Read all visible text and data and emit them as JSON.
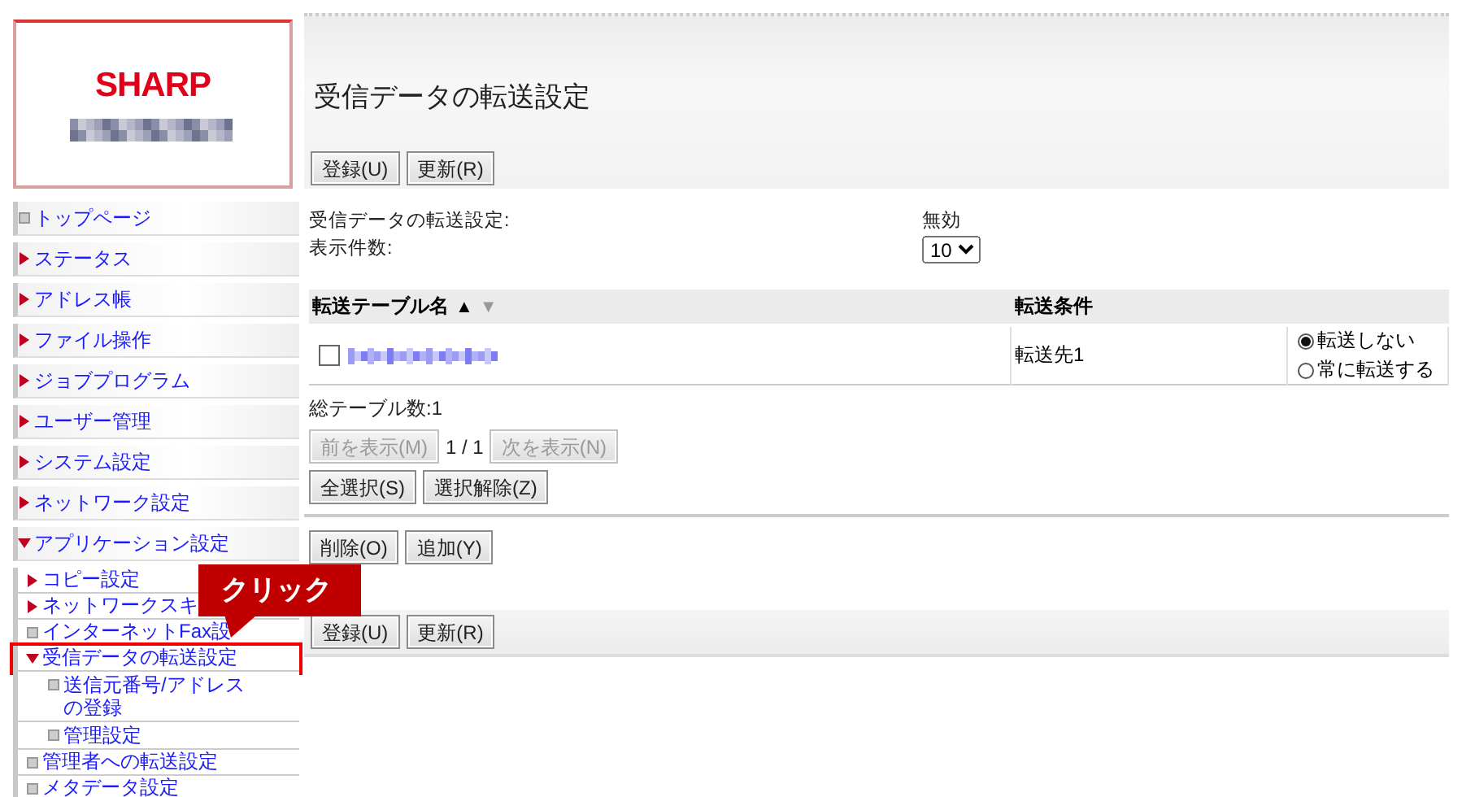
{
  "logo": {
    "brand": "SHARP"
  },
  "sidebar": {
    "items": [
      {
        "label": "トップページ",
        "kind": "page"
      },
      {
        "label": "ステータス",
        "kind": "folder",
        "expanded": false
      },
      {
        "label": "アドレス帳",
        "kind": "folder",
        "expanded": false
      },
      {
        "label": "ファイル操作",
        "kind": "folder",
        "expanded": false
      },
      {
        "label": "ジョブプログラム",
        "kind": "folder",
        "expanded": false
      },
      {
        "label": "ユーザー管理",
        "kind": "folder",
        "expanded": false
      },
      {
        "label": "システム設定",
        "kind": "folder",
        "expanded": false
      },
      {
        "label": "ネットワーク設定",
        "kind": "folder",
        "expanded": false
      },
      {
        "label": "アプリケーション設定",
        "kind": "folder",
        "expanded": true,
        "children": [
          {
            "label": "コピー設定",
            "kind": "folder",
            "expanded": false
          },
          {
            "label": "ネットワークスキ",
            "kind": "folder",
            "expanded": false
          },
          {
            "label": "インターネットFax設",
            "kind": "page"
          },
          {
            "label": "受信データの転送設定",
            "kind": "folder",
            "expanded": true,
            "highlighted": true,
            "children": [
              {
                "label": "送信元番号/アドレスの登録",
                "kind": "page"
              },
              {
                "label": "管理設定",
                "kind": "page"
              }
            ]
          },
          {
            "label": "管理者への転送設定",
            "kind": "page"
          },
          {
            "label": "メタデータ設定",
            "kind": "page"
          }
        ]
      }
    ]
  },
  "callout": {
    "text": "クリック"
  },
  "page": {
    "title": "受信データの転送設定",
    "top_buttons": [
      {
        "label": "登録(U)"
      },
      {
        "label": "更新(R)"
      }
    ],
    "fields": [
      {
        "label": "受信データの転送設定:",
        "kind": "text",
        "value": "無効"
      },
      {
        "label": "表示件数:",
        "kind": "select",
        "value": "10"
      }
    ],
    "table": {
      "columns": [
        {
          "label": "転送テーブル名",
          "sort_asc": "▲",
          "sort_desc": "▼"
        },
        {
          "label": "転送条件"
        }
      ],
      "rows": [
        {
          "checked": false,
          "condition": "転送先1",
          "options": [
            {
              "label": "転送しない",
              "selected": true
            },
            {
              "label": "常に転送する",
              "selected": false
            }
          ]
        }
      ]
    },
    "total": "総テーブル数:1",
    "pager": {
      "prev": {
        "label": "前を表示(M)",
        "disabled": true
      },
      "page": "1 / 1",
      "next": {
        "label": "次を表示(N)",
        "disabled": true
      }
    },
    "select_buttons": [
      {
        "label": "全選択(S)"
      },
      {
        "label": "選択解除(Z)"
      }
    ],
    "action_buttons": [
      {
        "label": "削除(O)"
      },
      {
        "label": "追加(Y)"
      }
    ],
    "bottom_buttons": [
      {
        "label": "登録(U)"
      },
      {
        "label": "更新(R)"
      }
    ]
  }
}
